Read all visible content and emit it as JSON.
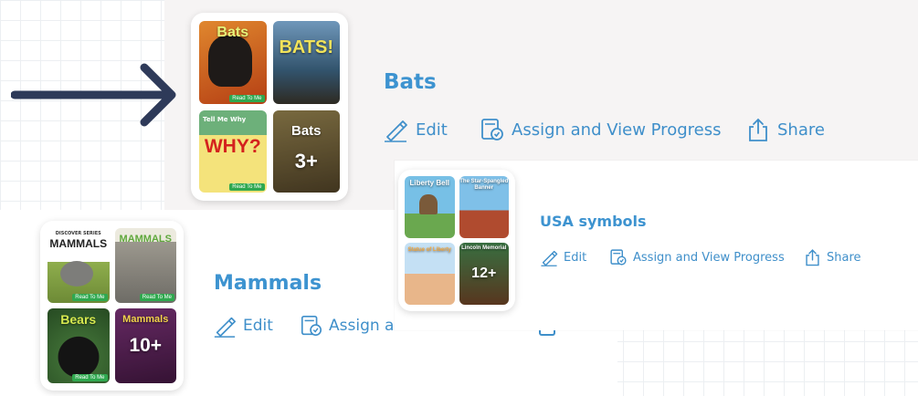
{
  "collections": [
    {
      "title": "Bats",
      "covers": [
        {
          "title": "Bats",
          "badge": "Read To Me",
          "bg": "#c9561e"
        },
        {
          "title": "BATS!",
          "badge": "",
          "bg": "#3a5d7e"
        },
        {
          "title": "WHY?",
          "subtitle": "Tell Me Why",
          "badge": "Read To Me",
          "bg": "#e8d35a"
        },
        {
          "title": "Bats",
          "count": "3+",
          "bg": "#7d6a3d"
        }
      ],
      "actions": {
        "edit": "Edit",
        "assign": "Assign and View Progress",
        "share": "Share"
      }
    },
    {
      "title": "USA symbols",
      "covers": [
        {
          "title": "Liberty Bell",
          "bg": "#6cb8dd"
        },
        {
          "title": "The Star-Spangled Banner",
          "bg": "#74b9e0"
        },
        {
          "title": "Statue of Liberty",
          "bg": "#b8d8ef"
        },
        {
          "title": "Lincoln Memorial",
          "count": "12+",
          "bg": "#5f9c67"
        }
      ],
      "actions": {
        "edit": "Edit",
        "assign": "Assign and View Progress",
        "share": "Share"
      }
    },
    {
      "title": "Mammals",
      "covers": [
        {
          "title": "MAMMALS",
          "series": "DISCOVER SERIES",
          "badge": "Read To Me",
          "bg": "#ffffff"
        },
        {
          "title": "MAMMALS",
          "badge": "Read To Me",
          "bg": "#8c8a83"
        },
        {
          "title": "Bears",
          "badge": "Read To Me",
          "bg": "#2f5c2b"
        },
        {
          "title": "Mammals",
          "count": "10+",
          "bg": "#6a2c6b"
        }
      ],
      "actions": {
        "edit": "Edit",
        "assign": "Assign ar"
      }
    }
  ]
}
